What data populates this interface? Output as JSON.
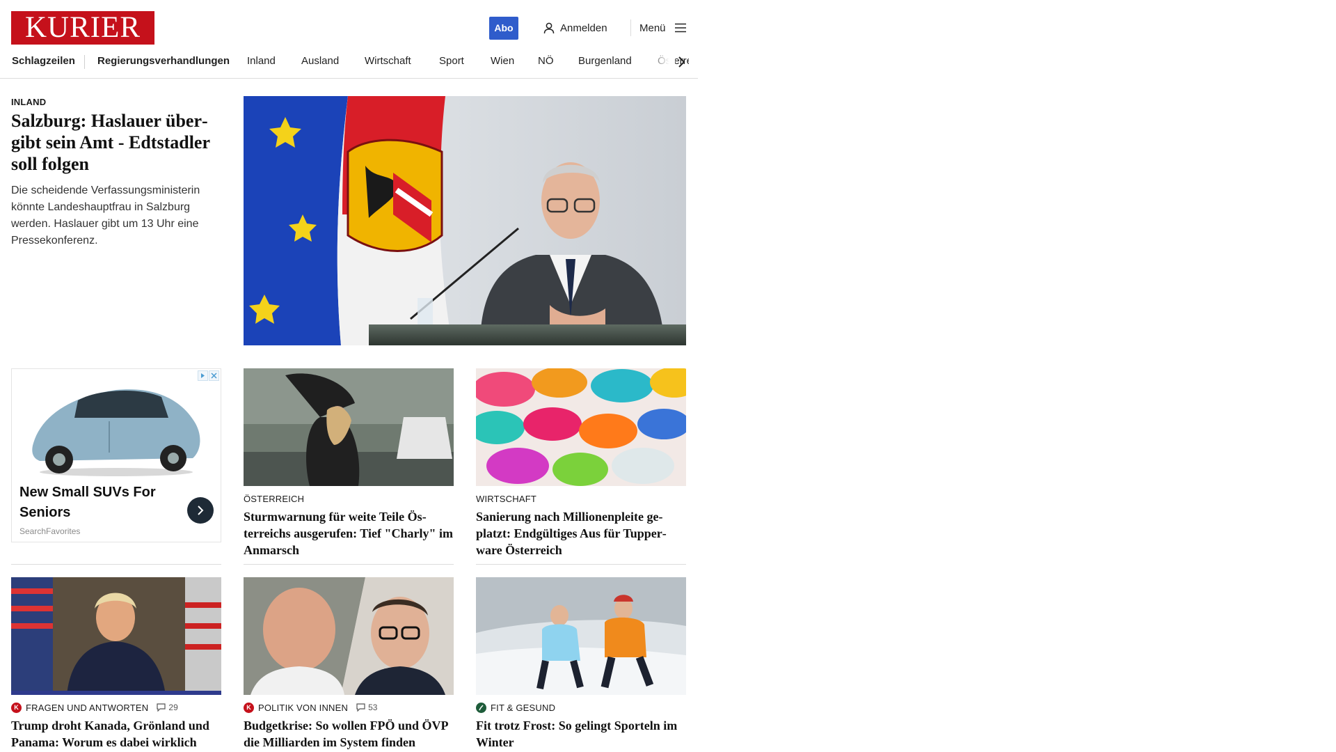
{
  "header": {
    "logo_text": "KURIER",
    "abo_label": "Abo",
    "login_label": "Anmelden",
    "menu_label": "Menü"
  },
  "nav": {
    "items": [
      "Schlagzeilen",
      "Regierungsverhandlungen",
      "Inland",
      "Ausland",
      "Wirtschaft",
      "Sport",
      "Wien",
      "NÖ",
      "Burgenland",
      "Österreich"
    ]
  },
  "lead": {
    "kicker": "Inland",
    "headline": "Salzburg: Haslauer über­gibt sein Amt - Edtstadler soll folgen",
    "text": "Die scheidende Verfassungsministerin könnte Landeshauptfrau in Salzburg werden. Haslauer gibt um 13 Uhr eine Pressekonferenz."
  },
  "ad": {
    "title": "New Small SUVs For Seniors",
    "source": "SearchFavorites"
  },
  "row1": [
    {
      "kicker": "Österreich",
      "headline": "Sturmwarnung für weite Teile Ös­terreichs ausgerufen: Tief \"Charly\" im Anmarsch"
    },
    {
      "kicker": "Wirtschaft",
      "headline": "Sanierung nach Millionenpleite ge­platzt: Endgültiges Aus für Tupper­ware Österreich"
    }
  ],
  "row2": [
    {
      "kicker": "Fragen und Antworten",
      "comments": "29",
      "headline": "Trump droht Kanada, Grönland und Panama: Worum es dabei wirklich geht"
    },
    {
      "kicker": "Politik von innen",
      "comments": "53",
      "headline": "Budgetkrise: So wollen FPÖ und ÖVP die Milliarden im System finden"
    },
    {
      "kicker": "Fit & Gesund",
      "headline": "Fit trotz Frost: So gelingt Sporteln im Winter"
    }
  ],
  "colors": {
    "brand_red": "#c5111b",
    "abo_blue": "#2f5ccb",
    "fit_green": "#1e5c3a"
  }
}
